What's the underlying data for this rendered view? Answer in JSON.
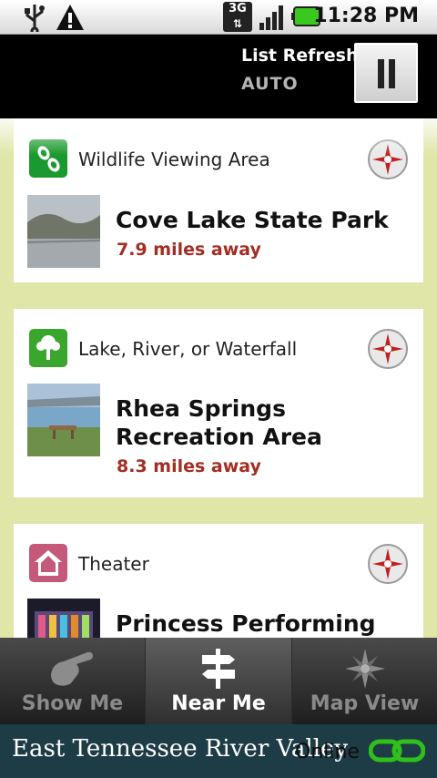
{
  "status_bar": {
    "time": "11:28 PM",
    "network": "3G",
    "icons": [
      "usb-icon",
      "warning-icon",
      "network-3g-icon",
      "signal-icon",
      "battery-icon"
    ]
  },
  "header": {
    "refresh_label": "List Refresh",
    "refresh_mode": "AUTO",
    "pause_icon": "pause-icon"
  },
  "list": {
    "items": [
      {
        "category": "Wildlife Viewing Area",
        "category_icon": "footprint-icon",
        "category_color": "#1a9a2e",
        "name": "Cove Lake State Park",
        "distance": "7.9 miles away"
      },
      {
        "category": "Lake, River, or Waterfall",
        "category_icon": "tree-icon",
        "category_color": "#3aa62d",
        "name_line1": "Rhea Springs",
        "name_line2": "Recreation Area",
        "distance": "8.3 miles away"
      },
      {
        "category": "Theater",
        "category_icon": "house-icon",
        "category_color": "#c4597a",
        "name": "Princess Performing"
      }
    ]
  },
  "tabs": [
    {
      "label": "Show Me",
      "icon": "pointing-hand-icon",
      "active": false
    },
    {
      "label": "Near Me",
      "icon": "signpost-icon",
      "active": true
    },
    {
      "label": "Map View",
      "icon": "compass-star-icon",
      "active": false
    }
  ],
  "footer": {
    "brand": "East Tennessee River Valley",
    "status": "Online",
    "status_icon": "link-icon",
    "status_color": "#2fc01a"
  },
  "colors": {
    "distance": "#a22e24",
    "list_background": "#dfe6a8",
    "footer": "#1d3c46"
  }
}
